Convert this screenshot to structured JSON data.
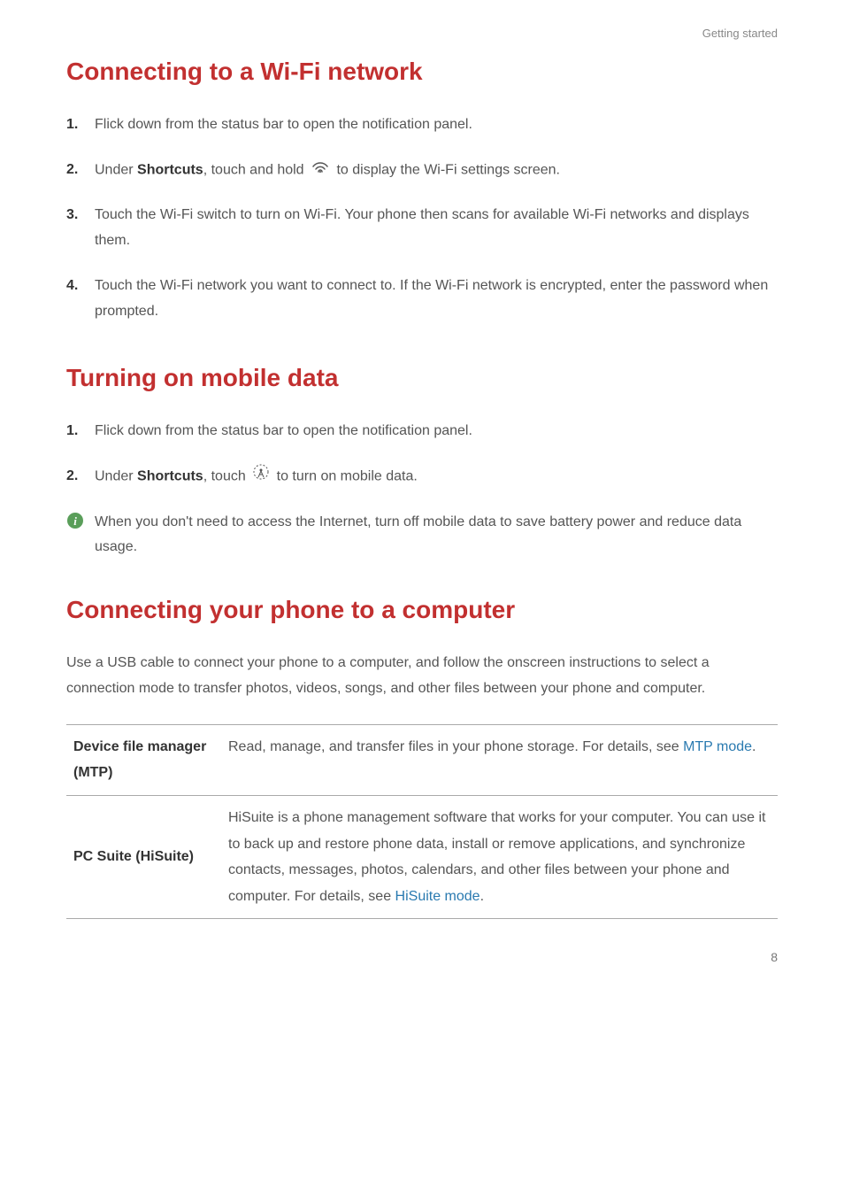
{
  "header": {
    "breadcrumb": "Getting started"
  },
  "section1": {
    "title": "Connecting to a Wi-Fi network",
    "steps": [
      {
        "num": "1.",
        "text_before": "Flick down from the status bar to open the notification panel."
      },
      {
        "num": "2.",
        "text_before": "Under ",
        "bold1": "Shortcuts",
        "text_mid": ", touch and hold ",
        "icon": "wifi",
        "text_after": " to display the Wi-Fi settings screen."
      },
      {
        "num": "3.",
        "text_before": "Touch the Wi-Fi switch to turn on Wi-Fi. Your phone then scans for available Wi-Fi networks and displays them."
      },
      {
        "num": "4.",
        "text_before": "Touch the Wi-Fi network you want to connect to. If the Wi-Fi network is encrypted, enter the password when prompted."
      }
    ]
  },
  "section2": {
    "title": "Turning on mobile data",
    "steps": [
      {
        "num": "1.",
        "text_before": "Flick down from the status bar to open the notification panel."
      },
      {
        "num": "2.",
        "text_before": "Under ",
        "bold1": "Shortcuts",
        "text_mid": ", touch ",
        "icon": "antenna",
        "text_after": " to turn on mobile data."
      }
    ],
    "note": "When you don't need to access the Internet, turn off mobile data to save battery power and reduce data usage."
  },
  "section3": {
    "title": "Connecting your phone to a computer",
    "paragraph": "Use a USB cable to connect your phone to a computer, and follow the onscreen instructions to select a connection mode to transfer photos, videos, songs, and other files between your phone and computer.",
    "table": [
      {
        "label": "Device file manager (MTP)",
        "desc_before": "Read, manage, and transfer files in your phone storage. For details, see ",
        "link": "MTP mode",
        "desc_after": "."
      },
      {
        "label": "PC Suite (HiSuite)",
        "desc_before": "HiSuite is a phone management software that works for your computer. You can use it to back up and restore phone data, install or remove applications, and synchronize contacts, messages, photos, calendars, and other files between your phone and computer. For details, see ",
        "link": "HiSuite mode",
        "desc_after": "."
      }
    ]
  },
  "footer": {
    "page_number": "8"
  }
}
